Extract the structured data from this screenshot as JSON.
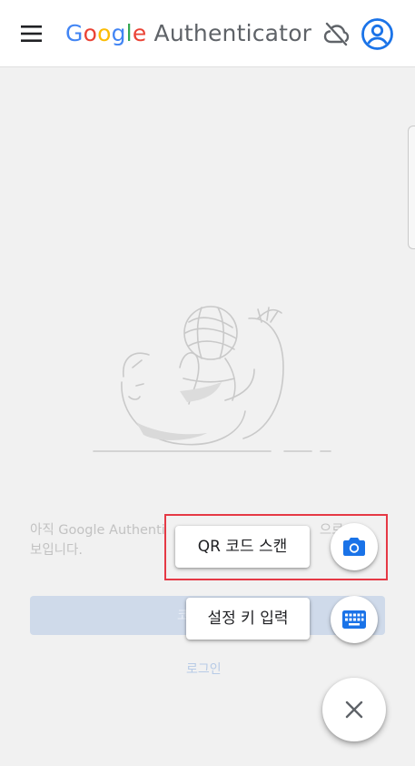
{
  "header": {
    "title_google_letters": [
      "G",
      "o",
      "o",
      "g",
      "l",
      "e"
    ],
    "title_rest": " Authenticator",
    "menu_icon": "hamburger-menu-icon",
    "sync_icon": "cloud-off-icon",
    "account_icon": "account-circle-icon"
  },
  "main": {
    "empty_state_text": "아직 Google Authenti… 으로 보입니다.",
    "empty_state_line1": "아직 Google Authenti",
    "empty_state_line1_end": "으로",
    "empty_state_line2": "보입니다.",
    "primary_button_label": "코",
    "login_link": "로그인"
  },
  "fab_menu": {
    "scan_qr_label": "QR 코드 스캔",
    "scan_qr_icon": "camera-icon",
    "enter_key_label": "설정 키 입력",
    "enter_key_icon": "keyboard-icon",
    "close_icon": "close-icon"
  },
  "colors": {
    "accent": "#1a73e8",
    "highlight": "#e53945",
    "overlay_background": "#f1f1f1"
  }
}
